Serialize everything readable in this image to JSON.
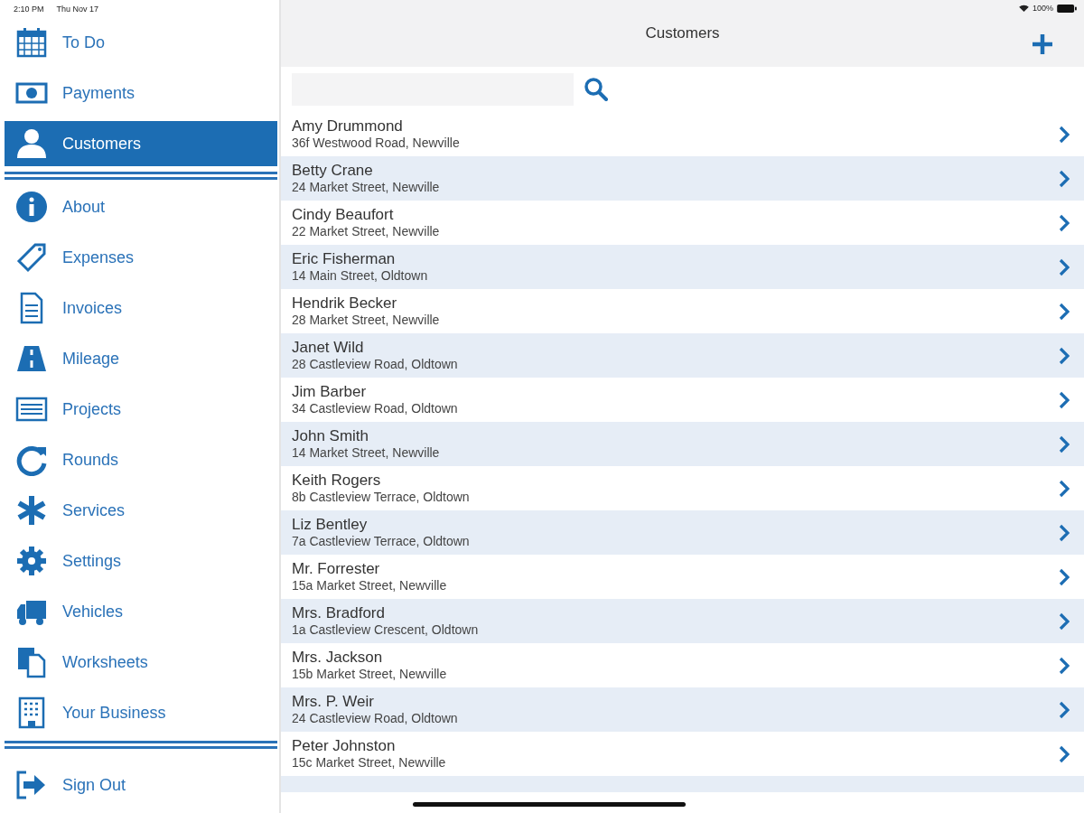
{
  "status_bar": {
    "time": "2:10 PM",
    "date": "Thu Nov 17",
    "battery": "100%"
  },
  "sidebar": {
    "sections": [
      [
        {
          "label": "To Do",
          "selected": false
        },
        {
          "label": "Payments",
          "selected": false
        },
        {
          "label": "Customers",
          "selected": true
        }
      ],
      [
        {
          "label": "About",
          "selected": false
        },
        {
          "label": "Expenses",
          "selected": false
        },
        {
          "label": "Invoices",
          "selected": false
        },
        {
          "label": "Mileage",
          "selected": false
        },
        {
          "label": "Projects",
          "selected": false
        },
        {
          "label": "Rounds",
          "selected": false
        },
        {
          "label": "Services",
          "selected": false
        },
        {
          "label": "Settings",
          "selected": false
        },
        {
          "label": "Vehicles",
          "selected": false
        },
        {
          "label": "Worksheets",
          "selected": false
        },
        {
          "label": "Your Business",
          "selected": false
        }
      ],
      [
        {
          "label": "Sign Out",
          "selected": false
        }
      ]
    ]
  },
  "nav": {
    "title": "Customers"
  },
  "customers": [
    {
      "name": "Amy Drummond",
      "address": "36f Westwood Road, Newville"
    },
    {
      "name": "Betty Crane",
      "address": "24 Market Street, Newville"
    },
    {
      "name": "Cindy Beaufort",
      "address": "22 Market Street, Newville"
    },
    {
      "name": "Eric Fisherman",
      "address": "14 Main Street, Oldtown"
    },
    {
      "name": "Hendrik Becker",
      "address": "28 Market Street, Newville"
    },
    {
      "name": "Janet Wild",
      "address": "28 Castleview Road, Oldtown"
    },
    {
      "name": "Jim Barber",
      "address": "34 Castleview Road, Oldtown"
    },
    {
      "name": "John Smith",
      "address": "14 Market Street, Newville"
    },
    {
      "name": "Keith Rogers",
      "address": "8b Castleview Terrace, Oldtown"
    },
    {
      "name": "Liz Bentley",
      "address": "7a Castleview Terrace, Oldtown"
    },
    {
      "name": "Mr. Forrester",
      "address": "15a Market Street, Newville"
    },
    {
      "name": "Mrs. Bradford",
      "address": "1a Castleview Crescent, Oldtown"
    },
    {
      "name": "Mrs. Jackson",
      "address": "15b Market Street, Newville"
    },
    {
      "name": "Mrs. P. Weir",
      "address": "24 Castleview Road, Oldtown"
    },
    {
      "name": "Peter Johnston",
      "address": "15c Market Street, Newville"
    }
  ]
}
